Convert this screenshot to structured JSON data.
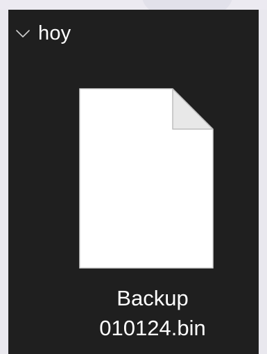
{
  "group": {
    "label": "hoy",
    "chevron_icon": "chevron-down-icon"
  },
  "file": {
    "icon": "generic-file-icon",
    "name_line1": "Backup",
    "name_line2": "010124.bin"
  },
  "colors": {
    "window_background": "#1f1f1f",
    "text": "#ffffff",
    "file_icon_fill": "#ffffff",
    "file_fold": "#e8e8e8",
    "page_background": "#e9e8ee"
  }
}
